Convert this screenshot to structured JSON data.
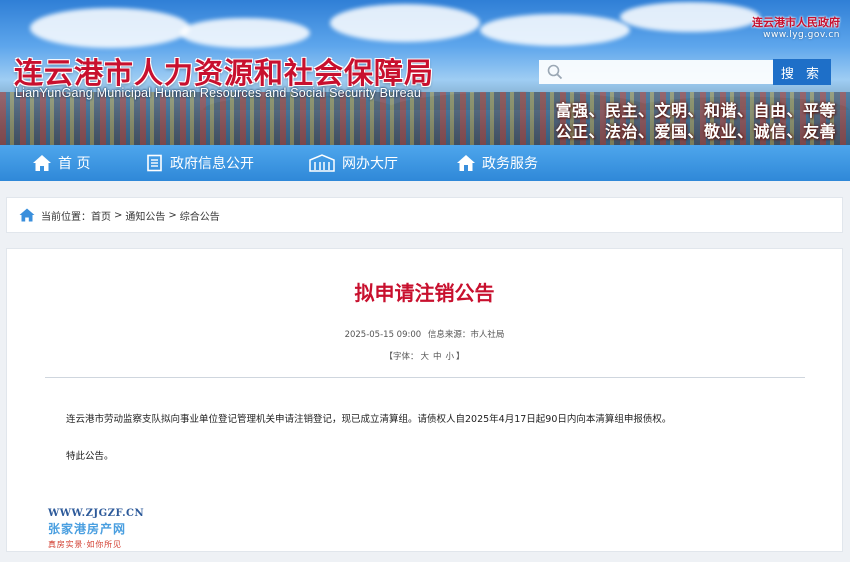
{
  "header": {
    "title_cn": "连云港市人力资源和社会保障局",
    "title_en": "LianYunGang Municipal Human Resources and Social Security Bureau",
    "gov_link_name": "连云港市人民政府",
    "gov_link_url": "www.lyg.gov.cn",
    "search_placeholder": "",
    "search_button": "搜 索",
    "values_line1": "富强、民主、文明、和谐、自由、平等",
    "values_line2": "公正、法治、爱国、敬业、诚信、友善"
  },
  "nav": {
    "items": [
      {
        "label": "首 页",
        "icon": "home-icon"
      },
      {
        "label": "政府信息公开",
        "icon": "document-icon"
      },
      {
        "label": "网办大厅",
        "icon": "building-icon"
      },
      {
        "label": "政务服务",
        "icon": "service-house-icon"
      }
    ]
  },
  "breadcrumb": {
    "prefix": "当前位置：",
    "items": [
      "首页",
      "通知公告",
      "综合公告"
    ],
    "separator": ">"
  },
  "article": {
    "title": "拟申请注销公告",
    "datetime": "2025-05-15 09:00",
    "source_label": "信息来源：",
    "source": "市人社局",
    "font_label": "【字体：",
    "font_large": "大",
    "font_medium": "中",
    "font_small": "小",
    "font_end": "】",
    "paragraphs": [
      "连云港市劳动监察支队拟向事业单位登记管理机关申请注销登记，现已成立清算组。请债权人自2025年4月17日起90日内向本清算组申报债权。",
      "特此公告。"
    ]
  },
  "watermark": {
    "url": "WWW.ZJGZF.CN",
    "name": "张家港房产网",
    "slogan": "真房实景·如你所见"
  },
  "colors": {
    "accent_red": "#c8102e",
    "nav_blue": "#2f88d8",
    "button_blue": "#1e6fc8"
  }
}
